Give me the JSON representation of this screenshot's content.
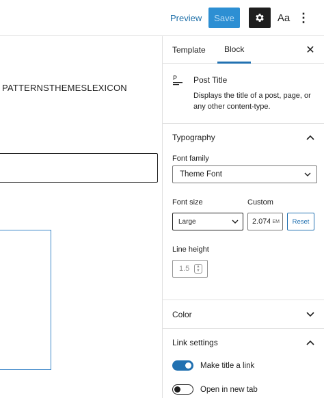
{
  "header": {
    "preview_label": "Preview",
    "save_label": "Save",
    "styles_label": "Aa",
    "more_icon": "⋮"
  },
  "canvas": {
    "nav_text": "PATTERNSTHEMESLEXICON"
  },
  "sidebar": {
    "tabs": [
      {
        "label": "Template"
      },
      {
        "label": "Block"
      }
    ],
    "close_icon": "✕",
    "block": {
      "icon": "P",
      "title": "Post Title",
      "description": "Displays the title of a post, page, or any other content-type."
    },
    "typography": {
      "heading": "Typography",
      "font_family_label": "Font family",
      "font_family_value": "Theme Font",
      "font_size_label": "Font size",
      "font_size_value": "Large",
      "custom_label": "Custom",
      "custom_value": "2.074",
      "custom_unit": "EM",
      "reset_label": "Reset",
      "line_height_label": "Line height",
      "line_height_value": "1.5"
    },
    "color": {
      "heading": "Color"
    },
    "link_settings": {
      "heading": "Link settings",
      "make_link_label": "Make title a link",
      "make_link_on": true,
      "new_tab_label": "Open in new tab",
      "new_tab_on": false
    }
  },
  "colors": {
    "accent": "#2271b1",
    "save_bg": "#2d8fd3",
    "dark": "#1e1e1e"
  }
}
